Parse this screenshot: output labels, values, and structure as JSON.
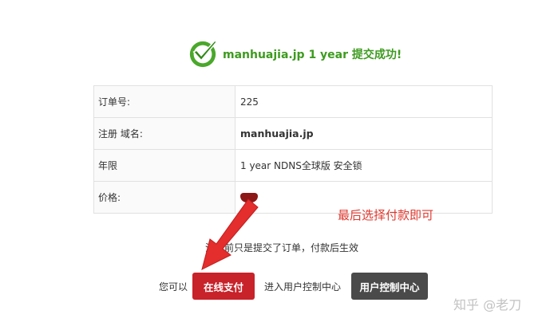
{
  "header": {
    "title": "manhuajia.jp 1 year 提交成功!"
  },
  "order": {
    "rows": [
      {
        "label": "订单号:",
        "value": "225"
      },
      {
        "label": "注册 域名:",
        "value": "manhuajia.jp"
      },
      {
        "label": "年限",
        "value": "1 year NDNS全球版 安全锁"
      },
      {
        "label": "价格:",
        "value": ""
      }
    ]
  },
  "annotation": "最后选择付款即可",
  "notice": {
    "prefix": "注",
    "text": "目前只是提交了订单，付款后生效"
  },
  "actions": {
    "prefix": "您可以",
    "pay_button": "在线支付",
    "middle_text": "进入用户控制中心",
    "panel_button": "用户控制中心"
  },
  "watermark": "知乎 @老刀",
  "colors": {
    "success_green": "#3d9b1f",
    "annotation_red": "#e0392f",
    "pay_button": "#c8222a",
    "panel_button": "#4a4a4a"
  }
}
